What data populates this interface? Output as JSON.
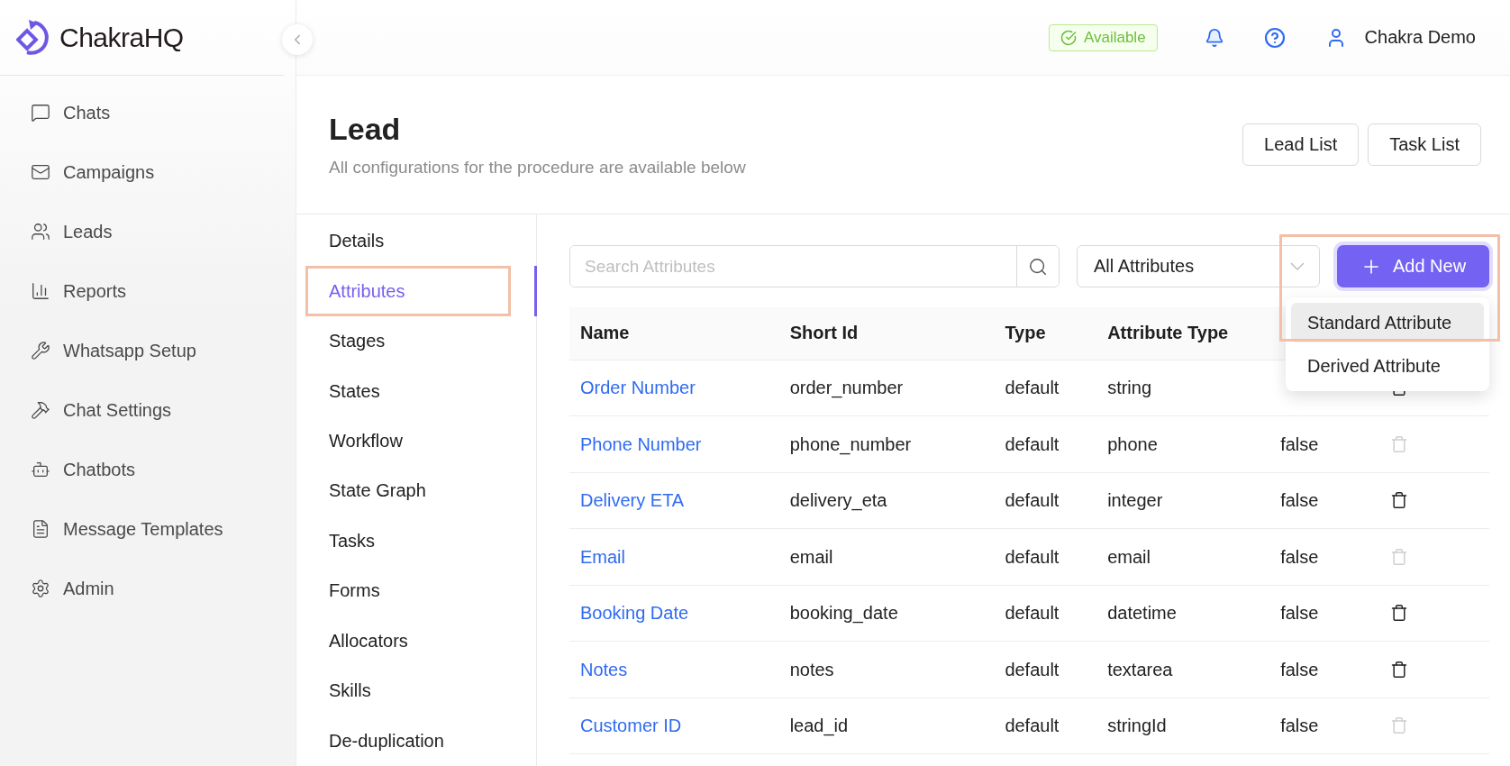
{
  "brand": {
    "name": "ChakraHQ"
  },
  "sidebar": {
    "items": [
      {
        "label": "Chats"
      },
      {
        "label": "Campaigns"
      },
      {
        "label": "Leads"
      },
      {
        "label": "Reports"
      },
      {
        "label": "Whatsapp Setup"
      },
      {
        "label": "Chat Settings"
      },
      {
        "label": "Chatbots"
      },
      {
        "label": "Message Templates"
      },
      {
        "label": "Admin"
      }
    ]
  },
  "header": {
    "status": "Available",
    "user": "Chakra Demo"
  },
  "page": {
    "title": "Lead",
    "subtitle": "All configurations for the procedure are available below",
    "buttons": [
      "Lead List",
      "Task List"
    ]
  },
  "sections": [
    {
      "label": "Details",
      "selected": false,
      "highlighted": false
    },
    {
      "label": "Attributes",
      "selected": true,
      "highlighted": true
    },
    {
      "label": "Stages",
      "selected": false,
      "highlighted": false
    },
    {
      "label": "States",
      "selected": false,
      "highlighted": false
    },
    {
      "label": "Workflow",
      "selected": false,
      "highlighted": false
    },
    {
      "label": "State Graph",
      "selected": false,
      "highlighted": false
    },
    {
      "label": "Tasks",
      "selected": false,
      "highlighted": false
    },
    {
      "label": "Forms",
      "selected": false,
      "highlighted": false
    },
    {
      "label": "Allocators",
      "selected": false,
      "highlighted": false
    },
    {
      "label": "Skills",
      "selected": false,
      "highlighted": false
    },
    {
      "label": "De-duplication",
      "selected": false,
      "highlighted": false
    }
  ],
  "toolbar": {
    "search_placeholder": "Search Attributes",
    "filter": "All Attributes",
    "add_button": "Add New",
    "add_highlighted": true
  },
  "add_menu": [
    {
      "label": "Standard Attribute",
      "hovered": true
    },
    {
      "label": "Derived Attribute",
      "hovered": false
    }
  ],
  "table": {
    "columns": [
      "Name",
      "Short Id",
      "Type",
      "Attribute Type"
    ],
    "rows": [
      {
        "name": "Order Number",
        "short_id": "order_number",
        "type": "default",
        "attribute_type": "string",
        "deletable": true
      },
      {
        "name": "Phone Number",
        "short_id": "phone_number",
        "type": "default",
        "attribute_type": "phone",
        "column_5": "false",
        "deletable": false
      },
      {
        "name": "Delivery ETA",
        "short_id": "delivery_eta",
        "type": "default",
        "attribute_type": "integer",
        "column_5": "false",
        "deletable": true
      },
      {
        "name": "Email",
        "short_id": "email",
        "type": "default",
        "attribute_type": "email",
        "column_5": "false",
        "deletable": false
      },
      {
        "name": "Booking Date",
        "short_id": "booking_date",
        "type": "default",
        "attribute_type": "datetime",
        "column_5": "false",
        "deletable": true
      },
      {
        "name": "Notes",
        "short_id": "notes",
        "type": "default",
        "attribute_type": "textarea",
        "column_5": "false",
        "deletable": true
      },
      {
        "name": "Customer ID",
        "short_id": "lead_id",
        "type": "default",
        "attribute_type": "stringId",
        "column_5": "false",
        "deletable": false
      }
    ]
  }
}
